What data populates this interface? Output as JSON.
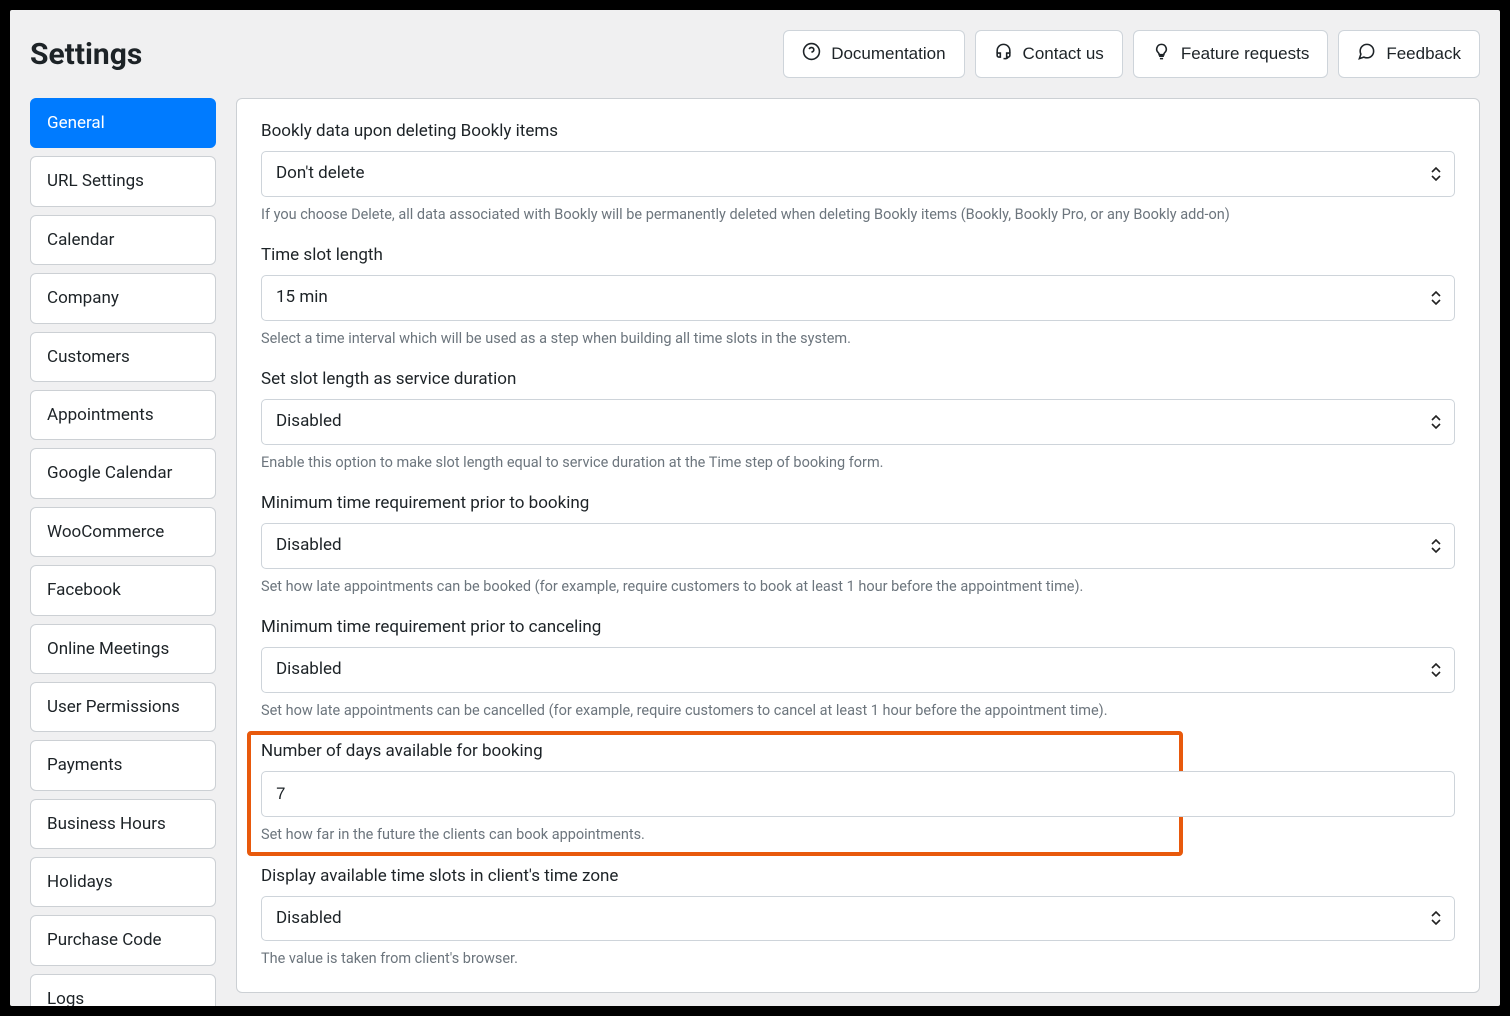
{
  "header": {
    "title": "Settings",
    "buttons": {
      "documentation": "Documentation",
      "contact": "Contact us",
      "feature": "Feature requests",
      "feedback": "Feedback"
    }
  },
  "sidebar": {
    "items": [
      "General",
      "URL Settings",
      "Calendar",
      "Company",
      "Customers",
      "Appointments",
      "Google Calendar",
      "WooCommerce",
      "Facebook",
      "Online Meetings",
      "User Permissions",
      "Payments",
      "Business Hours",
      "Holidays",
      "Purchase Code",
      "Logs"
    ]
  },
  "fields": {
    "delete_data": {
      "label": "Bookly data upon deleting Bookly items",
      "value": "Don't delete",
      "help": "If you choose Delete, all data associated with Bookly will be permanently deleted when deleting Bookly items (Bookly, Bookly Pro, or any Bookly add-on)"
    },
    "slot_length": {
      "label": "Time slot length",
      "value": "15 min",
      "help": "Select a time interval which will be used as a step when building all time slots in the system."
    },
    "service_duration": {
      "label": "Set slot length as service duration",
      "value": "Disabled",
      "help": "Enable this option to make slot length equal to service duration at the Time step of booking form."
    },
    "min_booking": {
      "label": "Minimum time requirement prior to booking",
      "value": "Disabled",
      "help": "Set how late appointments can be booked (for example, require customers to book at least 1 hour before the appointment time)."
    },
    "min_cancel": {
      "label": "Minimum time requirement prior to canceling",
      "value": "Disabled",
      "help": "Set how late appointments can be cancelled (for example, require customers to cancel at least 1 hour before the appointment time)."
    },
    "days_available": {
      "label": "Number of days available for booking",
      "value": "7",
      "help": "Set how far in the future the clients can book appointments."
    },
    "client_timezone": {
      "label": "Display available time slots in client's time zone",
      "value": "Disabled",
      "help": "The value is taken from client's browser."
    }
  }
}
